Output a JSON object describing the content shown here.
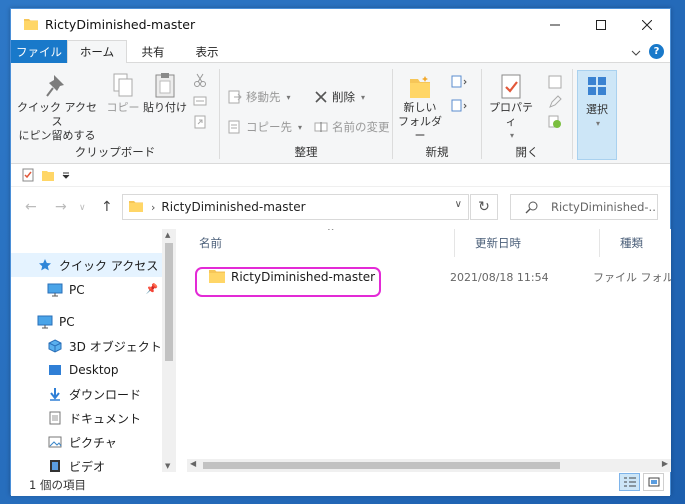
{
  "window": {
    "title": "RictyDiminished-master"
  },
  "tabs": {
    "file": "ファイル",
    "home": "ホーム",
    "share": "共有",
    "view": "表示"
  },
  "ribbon": {
    "clipboard": {
      "pin_label_1": "クイック アクセス",
      "pin_label_2": "にピン留めする",
      "copy": "コピー",
      "paste": "貼り付け",
      "group": "クリップボード"
    },
    "organize": {
      "move_to": "移動先",
      "copy_to": "コピー先",
      "delete": "削除",
      "rename": "名前の変更",
      "group": "整理"
    },
    "new": {
      "new_folder_1": "新しい",
      "new_folder_2": "フォルダー",
      "group": "新規"
    },
    "open": {
      "properties": "プロパティ",
      "group": "開く"
    },
    "select": {
      "label": "選択"
    }
  },
  "address": {
    "path": "RictyDiminished-master"
  },
  "search": {
    "placeholder": "RictyDiminished-..."
  },
  "nav": {
    "items": [
      {
        "label": "クイック アクセス"
      },
      {
        "label": "PC"
      },
      {
        "label": "PC"
      },
      {
        "label": "3D オブジェクト"
      },
      {
        "label": "Desktop"
      },
      {
        "label": "ダウンロード"
      },
      {
        "label": "ドキュメント"
      },
      {
        "label": "ピクチャ"
      },
      {
        "label": "ビデオ"
      }
    ]
  },
  "list": {
    "columns": {
      "name": "名前",
      "modified": "更新日時",
      "type": "種類"
    },
    "rows": [
      {
        "name": "RictyDiminished-master",
        "modified": "2021/08/18 11:54",
        "type": "ファイル フォルダー"
      }
    ]
  },
  "status": {
    "count": "1 個の項目"
  },
  "colors": {
    "accent": "#1979ca",
    "highlight": "#e32ad6",
    "selection": "#cde6f7"
  }
}
